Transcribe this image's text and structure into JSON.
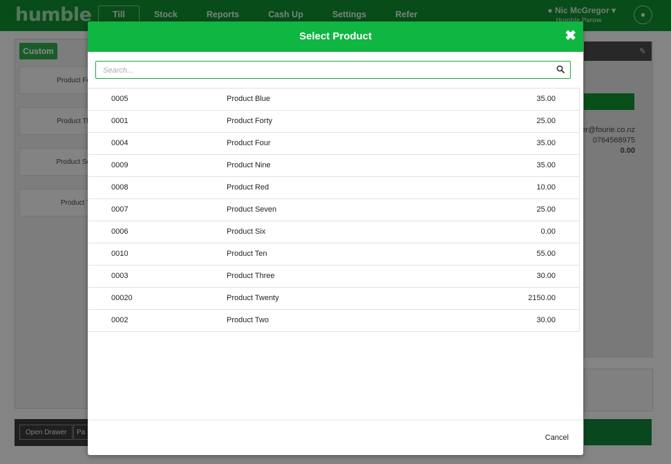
{
  "app": {
    "logo": "humble",
    "nav": [
      "Till",
      "Stock",
      "Reports",
      "Cash Up",
      "Settings",
      "Refer"
    ],
    "user_name": "Nic McGregor",
    "store": "Humble Parow"
  },
  "background": {
    "custom_button": "Custom",
    "tiles": [
      "Product Fo",
      "Product Th",
      "Product Se",
      "Product T"
    ],
    "customer_email": "er@fourie.co.nz",
    "customer_phone": "0764568975",
    "total": "0.00",
    "bottom_buttons": [
      "Open Drawer",
      "Pa"
    ]
  },
  "modal": {
    "title": "Select Product",
    "search_placeholder": "Search...",
    "cancel_label": "Cancel",
    "products": [
      {
        "code": "0005",
        "name": "Product Blue",
        "price": "35.00"
      },
      {
        "code": "0001",
        "name": "Product Forty",
        "price": "25.00"
      },
      {
        "code": "0004",
        "name": "Product Four",
        "price": "35.00"
      },
      {
        "code": "0009",
        "name": "Product Nine",
        "price": "35.00"
      },
      {
        "code": "0008",
        "name": "Product Red",
        "price": "10.00"
      },
      {
        "code": "0007",
        "name": "Product Seven",
        "price": "25.00"
      },
      {
        "code": "0006",
        "name": "Product Six",
        "price": "0.00"
      },
      {
        "code": "0010",
        "name": "Product Ten",
        "price": "55.00"
      },
      {
        "code": "0003",
        "name": "Product Three",
        "price": "30.00"
      },
      {
        "code": "00020",
        "name": "Product Twenty",
        "price": "2150.00"
      },
      {
        "code": "0002",
        "name": "Product Two",
        "price": "30.00"
      }
    ]
  },
  "colors": {
    "header_green": "#0fb641",
    "topbar_green": "#0f8a2e",
    "search_border": "#14a83d"
  }
}
